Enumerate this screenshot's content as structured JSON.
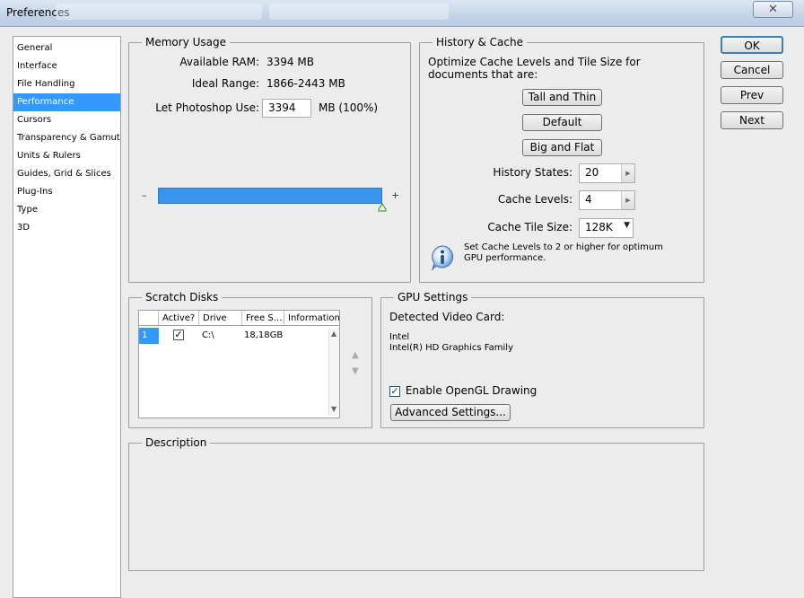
{
  "window": {
    "title": "Preferences",
    "close_glyph": "✕"
  },
  "sidebar": {
    "items": [
      {
        "label": "General"
      },
      {
        "label": "Interface"
      },
      {
        "label": "File Handling"
      },
      {
        "label": "Performance"
      },
      {
        "label": "Cursors"
      },
      {
        "label": "Transparency & Gamut"
      },
      {
        "label": "Units & Rulers"
      },
      {
        "label": "Guides, Grid & Slices"
      },
      {
        "label": "Plug-Ins"
      },
      {
        "label": "Type"
      },
      {
        "label": "3D"
      }
    ],
    "selected_index": 3
  },
  "buttons": {
    "ok": "OK",
    "cancel": "Cancel",
    "prev": "Prev",
    "next": "Next"
  },
  "memory": {
    "legend": "Memory Usage",
    "available_label": "Available RAM:",
    "available_value": "3394 MB",
    "ideal_label": "Ideal Range:",
    "ideal_value": "1866-2443 MB",
    "let_label": "Let Photoshop Use:",
    "let_value": "3394",
    "let_suffix": "MB (100%)",
    "slider_minus": "–",
    "slider_plus": "+",
    "slider_level": 1.0
  },
  "history": {
    "legend": "History & Cache",
    "description": "Optimize Cache Levels and Tile Size for documents that are:",
    "btn_tall": "Tall and Thin",
    "btn_default": "Default",
    "btn_big": "Big and Flat",
    "states_label": "History States:",
    "states_value": "20",
    "levels_label": "Cache Levels:",
    "levels_value": "4",
    "tile_label": "Cache Tile Size:",
    "tile_value": "128K",
    "info_text": "Set Cache Levels to 2 or higher for optimum GPU performance."
  },
  "scratch": {
    "legend": "Scratch Disks",
    "columns": [
      "Active?",
      "Drive",
      "Free S...",
      "Information"
    ],
    "rows": [
      {
        "num": "1",
        "active": true,
        "drive": "C:\\",
        "free": "18,18GB",
        "info": ""
      }
    ]
  },
  "gpu": {
    "legend": "GPU Settings",
    "detected_label": "Detected Video Card:",
    "vendor": "Intel",
    "card": "Intel(R) HD Graphics Family",
    "opengl_label": "Enable OpenGL Drawing",
    "opengl_checked": true,
    "advanced": "Advanced Settings..."
  },
  "description": {
    "legend": "Description"
  }
}
